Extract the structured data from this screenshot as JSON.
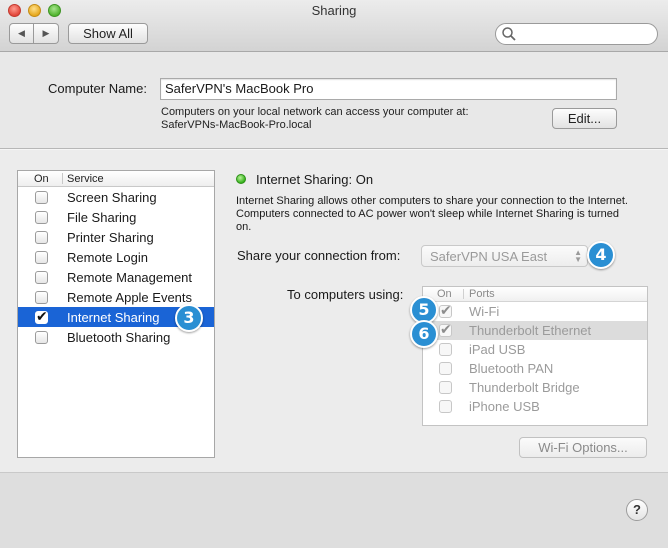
{
  "window": {
    "title": "Sharing"
  },
  "toolbar": {
    "back_icon": "◀",
    "forward_icon": "▶",
    "show_all_label": "Show All",
    "search_placeholder": ""
  },
  "computer": {
    "name_label": "Computer Name:",
    "name_value": "SaferVPN's MacBook Pro",
    "desc_line1": "Computers on your local network can access your computer at:",
    "desc_line2": "SaferVPNs-MacBook-Pro.local",
    "edit_label": "Edit..."
  },
  "services": {
    "header_on": "On",
    "header_service": "Service",
    "items": [
      {
        "label": "Screen Sharing",
        "checked": false,
        "selected": false
      },
      {
        "label": "File Sharing",
        "checked": false,
        "selected": false
      },
      {
        "label": "Printer Sharing",
        "checked": false,
        "selected": false
      },
      {
        "label": "Remote Login",
        "checked": false,
        "selected": false
      },
      {
        "label": "Remote Management",
        "checked": false,
        "selected": false
      },
      {
        "label": "Remote Apple Events",
        "checked": false,
        "selected": false
      },
      {
        "label": "Internet Sharing",
        "checked": true,
        "selected": true
      },
      {
        "label": "Bluetooth Sharing",
        "checked": false,
        "selected": false
      }
    ]
  },
  "internet_sharing": {
    "status": "Internet Sharing: On",
    "status_color": "#36b21c",
    "description": "Internet Sharing allows other computers to share your connection to the Internet. Computers connected to AC power won't sleep while Internet Sharing is turned on.",
    "share_from_label": "Share your connection from:",
    "share_from_value": "SaferVPN USA East",
    "to_computers_label": "To computers using:",
    "ports_header_on": "On",
    "ports_header_ports": "Ports",
    "ports": [
      {
        "label": "Wi-Fi",
        "checked": true,
        "highlight": false
      },
      {
        "label": "Thunderbolt Ethernet",
        "checked": true,
        "highlight": true
      },
      {
        "label": "iPad USB",
        "checked": false,
        "highlight": false
      },
      {
        "label": "Bluetooth PAN",
        "checked": false,
        "highlight": false
      },
      {
        "label": "Thunderbolt Bridge",
        "checked": false,
        "highlight": false
      },
      {
        "label": "iPhone USB",
        "checked": false,
        "highlight": false
      }
    ],
    "wifi_options_label": "Wi-Fi Options..."
  },
  "badges": {
    "b3": "3",
    "b4": "4",
    "b5": "5",
    "b6": "6",
    "color": "#2a8fd3"
  },
  "help": {
    "label": "?"
  }
}
